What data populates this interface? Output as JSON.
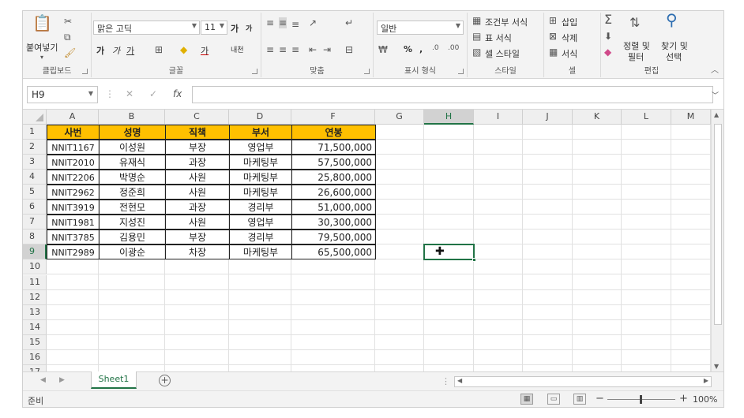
{
  "ribbon": {
    "clipboard": {
      "paste_label": "붙여넣기",
      "group_label": "클립보드"
    },
    "font": {
      "font_name": "맑은 고딕",
      "font_size": "11",
      "grow": "가",
      "shrink": "가",
      "bold": "가",
      "italic": "가",
      "underline": "가",
      "phonetic": "내천",
      "color_letter": "가",
      "group_label": "글꼴"
    },
    "alignment": {
      "group_label": "맞춤"
    },
    "number": {
      "format": "일반",
      "percent": "%",
      "comma": ",",
      "inc_decimal": "←.0\n.00",
      "dec_decimal": ".00\n→.0",
      "group_label": "표시 형식"
    },
    "styles": {
      "conditional": "조건부 서식",
      "as_table": "표 서식",
      "cell_styles": "셀 스타일",
      "group_label": "스타일"
    },
    "cells": {
      "insert": "삽입",
      "delete": "삭제",
      "format": "서식",
      "group_label": "셀"
    },
    "editing": {
      "sort_filter_1": "정렬 및",
      "sort_filter_2": "필터",
      "find_select_1": "찾기 및",
      "find_select_2": "선택",
      "group_label": "편집"
    }
  },
  "formula_bar": {
    "name_box": "H9",
    "fx": "fx",
    "formula": ""
  },
  "columns": [
    "A",
    "B",
    "C",
    "D",
    "F",
    "G",
    "H",
    "I",
    "J",
    "K",
    "L",
    "M"
  ],
  "rows": [
    "1",
    "2",
    "3",
    "4",
    "5",
    "6",
    "7",
    "8",
    "9",
    "10",
    "11",
    "12",
    "13",
    "14",
    "15",
    "16",
    "17"
  ],
  "table": {
    "headers": [
      "사번",
      "성명",
      "직책",
      "부서",
      "연봉"
    ],
    "rows": [
      [
        "NNIT1167",
        "이성원",
        "부장",
        "영업부",
        "71,500,000"
      ],
      [
        "NNIT2010",
        "유재식",
        "과장",
        "마케팅부",
        "57,500,000"
      ],
      [
        "NNIT2206",
        "박명순",
        "사원",
        "마케팅부",
        "25,800,000"
      ],
      [
        "NNIT2962",
        "정준희",
        "사원",
        "마케팅부",
        "26,600,000"
      ],
      [
        "NNIT3919",
        "전현모",
        "과장",
        "경리부",
        "51,000,000"
      ],
      [
        "NNIT1981",
        "지성진",
        "사원",
        "영업부",
        "30,300,000"
      ],
      [
        "NNIT3785",
        "김용민",
        "부장",
        "경리부",
        "79,500,000"
      ],
      [
        "NNIT2989",
        "이광순",
        "차장",
        "마케팅부",
        "65,500,000"
      ]
    ]
  },
  "selection": {
    "column": "H",
    "row": "9"
  },
  "sheet_tabs": [
    "Sheet1"
  ],
  "status": {
    "text": "준비",
    "zoom": "100%"
  },
  "colors": {
    "accent": "#217346",
    "header_fill": "#ffc000"
  }
}
